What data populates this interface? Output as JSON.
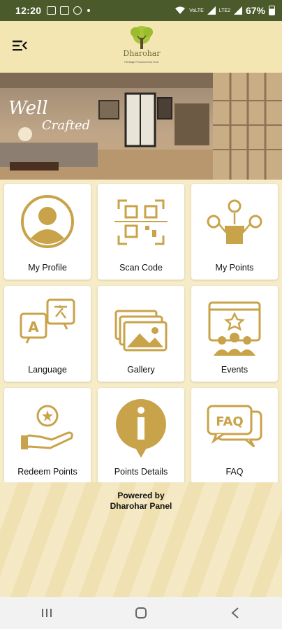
{
  "status_bar": {
    "time": "12:20",
    "battery": "67%",
    "volte_1": "VoLTE",
    "volte_2": "LTE2"
  },
  "header": {
    "logo_name": "Dharohar",
    "logo_tagline": "Heritage Preserved for Ever",
    "menu_icon": "menu-collapse-icon"
  },
  "banner": {
    "line1": "Well",
    "line2": "Crafted"
  },
  "tiles": [
    {
      "label": "My Profile",
      "icon": "profile-icon"
    },
    {
      "label": "Scan Code",
      "icon": "qr-scan-icon"
    },
    {
      "label": "My Points",
      "icon": "points-gift-icon"
    },
    {
      "label": "Language",
      "icon": "language-translate-icon"
    },
    {
      "label": "Gallery",
      "icon": "gallery-icon"
    },
    {
      "label": "Events",
      "icon": "events-calendar-icon"
    },
    {
      "label": "Redeem Points",
      "icon": "redeem-hand-coin-icon"
    },
    {
      "label": "Points Details",
      "icon": "info-icon"
    },
    {
      "label": "FAQ",
      "icon": "faq-bubble-icon"
    }
  ],
  "footer": {
    "line1": "Powered by",
    "line2": "Dharohar Panel"
  },
  "colors": {
    "accent": "#c9a34a",
    "status_bar": "#4a5a2a",
    "header_bg": "#f3e6b3",
    "page_bg": "#f6ecc8"
  }
}
